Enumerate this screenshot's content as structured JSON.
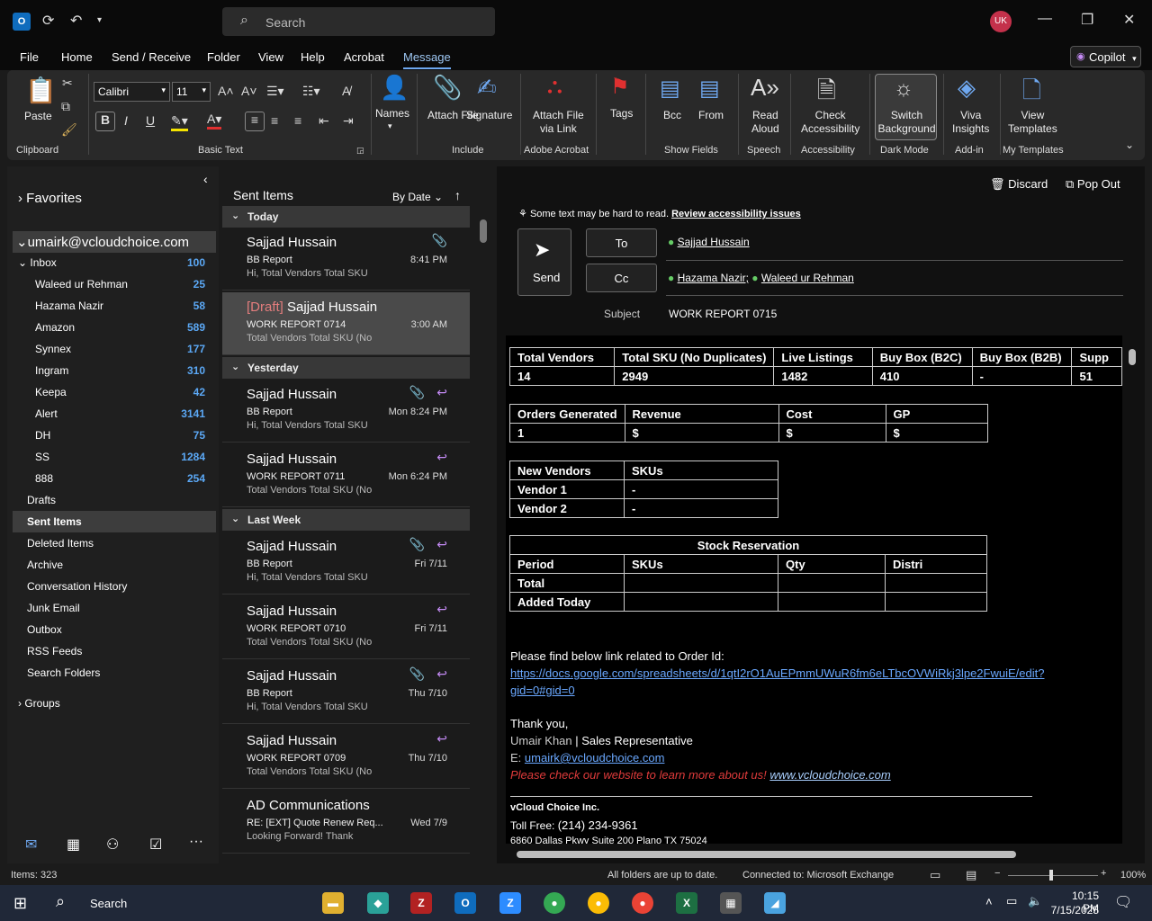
{
  "titlebar": {
    "app_icon": "outlook-icon",
    "search_placeholder": "Search",
    "avatar": "UK"
  },
  "menu": [
    "File",
    "Home",
    "Send / Receive",
    "Folder",
    "View",
    "Help",
    "Acrobat",
    "Message"
  ],
  "copilot": "Copilot",
  "ribbon": {
    "paste": "Paste",
    "clipboard": "Clipboard",
    "font": "Calibri",
    "size": "11",
    "basic_text": "Basic Text",
    "names": "Names",
    "attach_file": "Attach File",
    "signature": "Signature",
    "include": "Include",
    "attach_link1": "Attach File",
    "attach_link2": "via Link",
    "adobe": "Adobe Acrobat",
    "tags": "Tags",
    "bcc": "Bcc",
    "from": "From",
    "show_fields": "Show Fields",
    "read_aloud1": "Read",
    "read_aloud2": "Aloud",
    "speech": "Speech",
    "check_acc1": "Check",
    "check_acc2": "Accessibility",
    "accessibility": "Accessibility",
    "switch_bg1": "Switch",
    "switch_bg2": "Background",
    "dark_mode": "Dark Mode",
    "viva1": "Viva",
    "viva2": "Insights",
    "addin": "Add-in",
    "view_tpl1": "View",
    "view_tpl2": "Templates",
    "my_templates": "My Templates"
  },
  "nav": {
    "favorites": "Favorites",
    "account": "umairk@vcloudchoice.com",
    "inbox": {
      "label": "Inbox",
      "count": "100"
    },
    "folders": [
      {
        "label": "Waleed ur Rehman",
        "count": "25"
      },
      {
        "label": "Hazama Nazir",
        "count": "58"
      },
      {
        "label": "Amazon",
        "count": "589"
      },
      {
        "label": "Synnex",
        "count": "177"
      },
      {
        "label": "Ingram",
        "count": "310"
      },
      {
        "label": "Keepa",
        "count": "42"
      },
      {
        "label": "Alert",
        "count": "3141"
      },
      {
        "label": "DH",
        "count": "75"
      },
      {
        "label": "SS",
        "count": "1284"
      },
      {
        "label": "888",
        "count": "254"
      }
    ],
    "others": [
      "Drafts",
      "Sent Items",
      "Deleted Items",
      "Archive",
      "Conversation History",
      "Junk Email",
      "Outbox",
      "RSS Feeds",
      "Search Folders"
    ],
    "groups": "Groups"
  },
  "list": {
    "title": "Sent Items",
    "sort": "By Date",
    "groups": [
      "Today",
      "Yesterday",
      "Last Week"
    ],
    "messages": [
      {
        "draft": "",
        "from": "Sajjad Hussain",
        "subj": "BB Report",
        "prev": "Hi,  Total Vendors  Total SKU",
        "time": "8:41 PM"
      },
      {
        "draft": "[Draft]",
        "from": " Sajjad Hussain",
        "subj": "WORK REPORT 0714",
        "prev": "Total Vendors  Total SKU (No",
        "time": "3:00 AM"
      },
      {
        "draft": "",
        "from": "Sajjad Hussain",
        "subj": "BB Report",
        "prev": "Hi,  Total Vendors  Total SKU",
        "time": "Mon 8:24 PM"
      },
      {
        "draft": "",
        "from": "Sajjad Hussain",
        "subj": "WORK REPORT 0711",
        "prev": "Total Vendors  Total SKU (No",
        "time": "Mon 6:24 PM"
      },
      {
        "draft": "",
        "from": "Sajjad Hussain",
        "subj": "BB Report",
        "prev": "Hi,  Total Vendors  Total SKU",
        "time": "Fri 7/11"
      },
      {
        "draft": "",
        "from": "Sajjad Hussain",
        "subj": "WORK REPORT 0710",
        "prev": "Total Vendors  Total SKU (No",
        "time": "Fri 7/11"
      },
      {
        "draft": "",
        "from": "Sajjad Hussain",
        "subj": "BB Report",
        "prev": "Hi,  Total Vendors  Total SKU",
        "time": "Thu 7/10"
      },
      {
        "draft": "",
        "from": "Sajjad Hussain",
        "subj": "WORK REPORT 0709",
        "prev": "Total Vendors  Total SKU (No",
        "time": "Thu 7/10"
      },
      {
        "draft": "",
        "from": "AD Communications",
        "subj": "RE: [EXT] Quote Renew Req...",
        "prev": "Looking Forward!  Thank",
        "time": "Wed 7/9"
      }
    ]
  },
  "compose": {
    "discard": "Discard",
    "popout": "Pop Out",
    "access_note": "Some text may be hard to read.",
    "access_link": "Review accessibility issues",
    "send": "Send",
    "to_btn": "To",
    "cc_btn": "Cc",
    "to": "Sajjad Hussain",
    "cc1": "Hazama Nazir;",
    "cc2": "Waleed ur Rehman",
    "subject_label": "Subject",
    "subject": "WORK REPORT 0715"
  },
  "body": {
    "t1_head": [
      "Total Vendors",
      "Total SKU (No Duplicates)",
      "Live Listings",
      "Buy Box (B2C)",
      "Buy Box (B2B)",
      "Supp"
    ],
    "t1_vals": [
      "14",
      "2949",
      "1482",
      "410",
      "-",
      "51"
    ],
    "t2_head": [
      "Orders Generated",
      "Revenue",
      "Cost",
      "GP"
    ],
    "t2_vals": [
      "1",
      "$",
      "$",
      "$"
    ],
    "t3_head": [
      "New Vendors",
      "SKUs"
    ],
    "t3_rows": [
      [
        "Vendor 1",
        "-"
      ],
      [
        "Vendor 2",
        "-"
      ]
    ],
    "t4_title": "Stock Reservation",
    "t4_head": [
      "Period",
      "SKUs",
      "Qty",
      "Distri"
    ],
    "t4_rows": [
      "Total",
      "Added Today"
    ],
    "intro": "Please find below link related to Order Id:",
    "link1": "https://docs.google.com/spreadsheets/d/1qtI2rO1AuEPmmUWuR6fm6eLTbcOVWiRkj3lpe2FwuiE/edit?",
    "link2": "gid=0#gid=0",
    "thanks": "Thank you,",
    "sig_name": "Umair Khan",
    "sig_title": " | Sales Representative",
    "sig_e": "E: ",
    "sig_email": "umairk@vcloudchoice.com",
    "sig_promo": "Please check our website to learn more about us! ",
    "sig_site": "www.vcloudchoice.com",
    "company": "vCloud Choice Inc.",
    "toll_label": "Toll Free: ",
    "toll": "(214) 234-9361",
    "address": "6860 Dallas Pkwy Suite 200 Plano TX 75024"
  },
  "status": {
    "items": "Items: 323",
    "sync": "All folders are up to date.",
    "conn": "Connected to: Microsoft Exchange",
    "zoom": "100%"
  },
  "taskbar": {
    "search": "Search",
    "time": "10:15 PM",
    "date": "7/15/2025"
  }
}
